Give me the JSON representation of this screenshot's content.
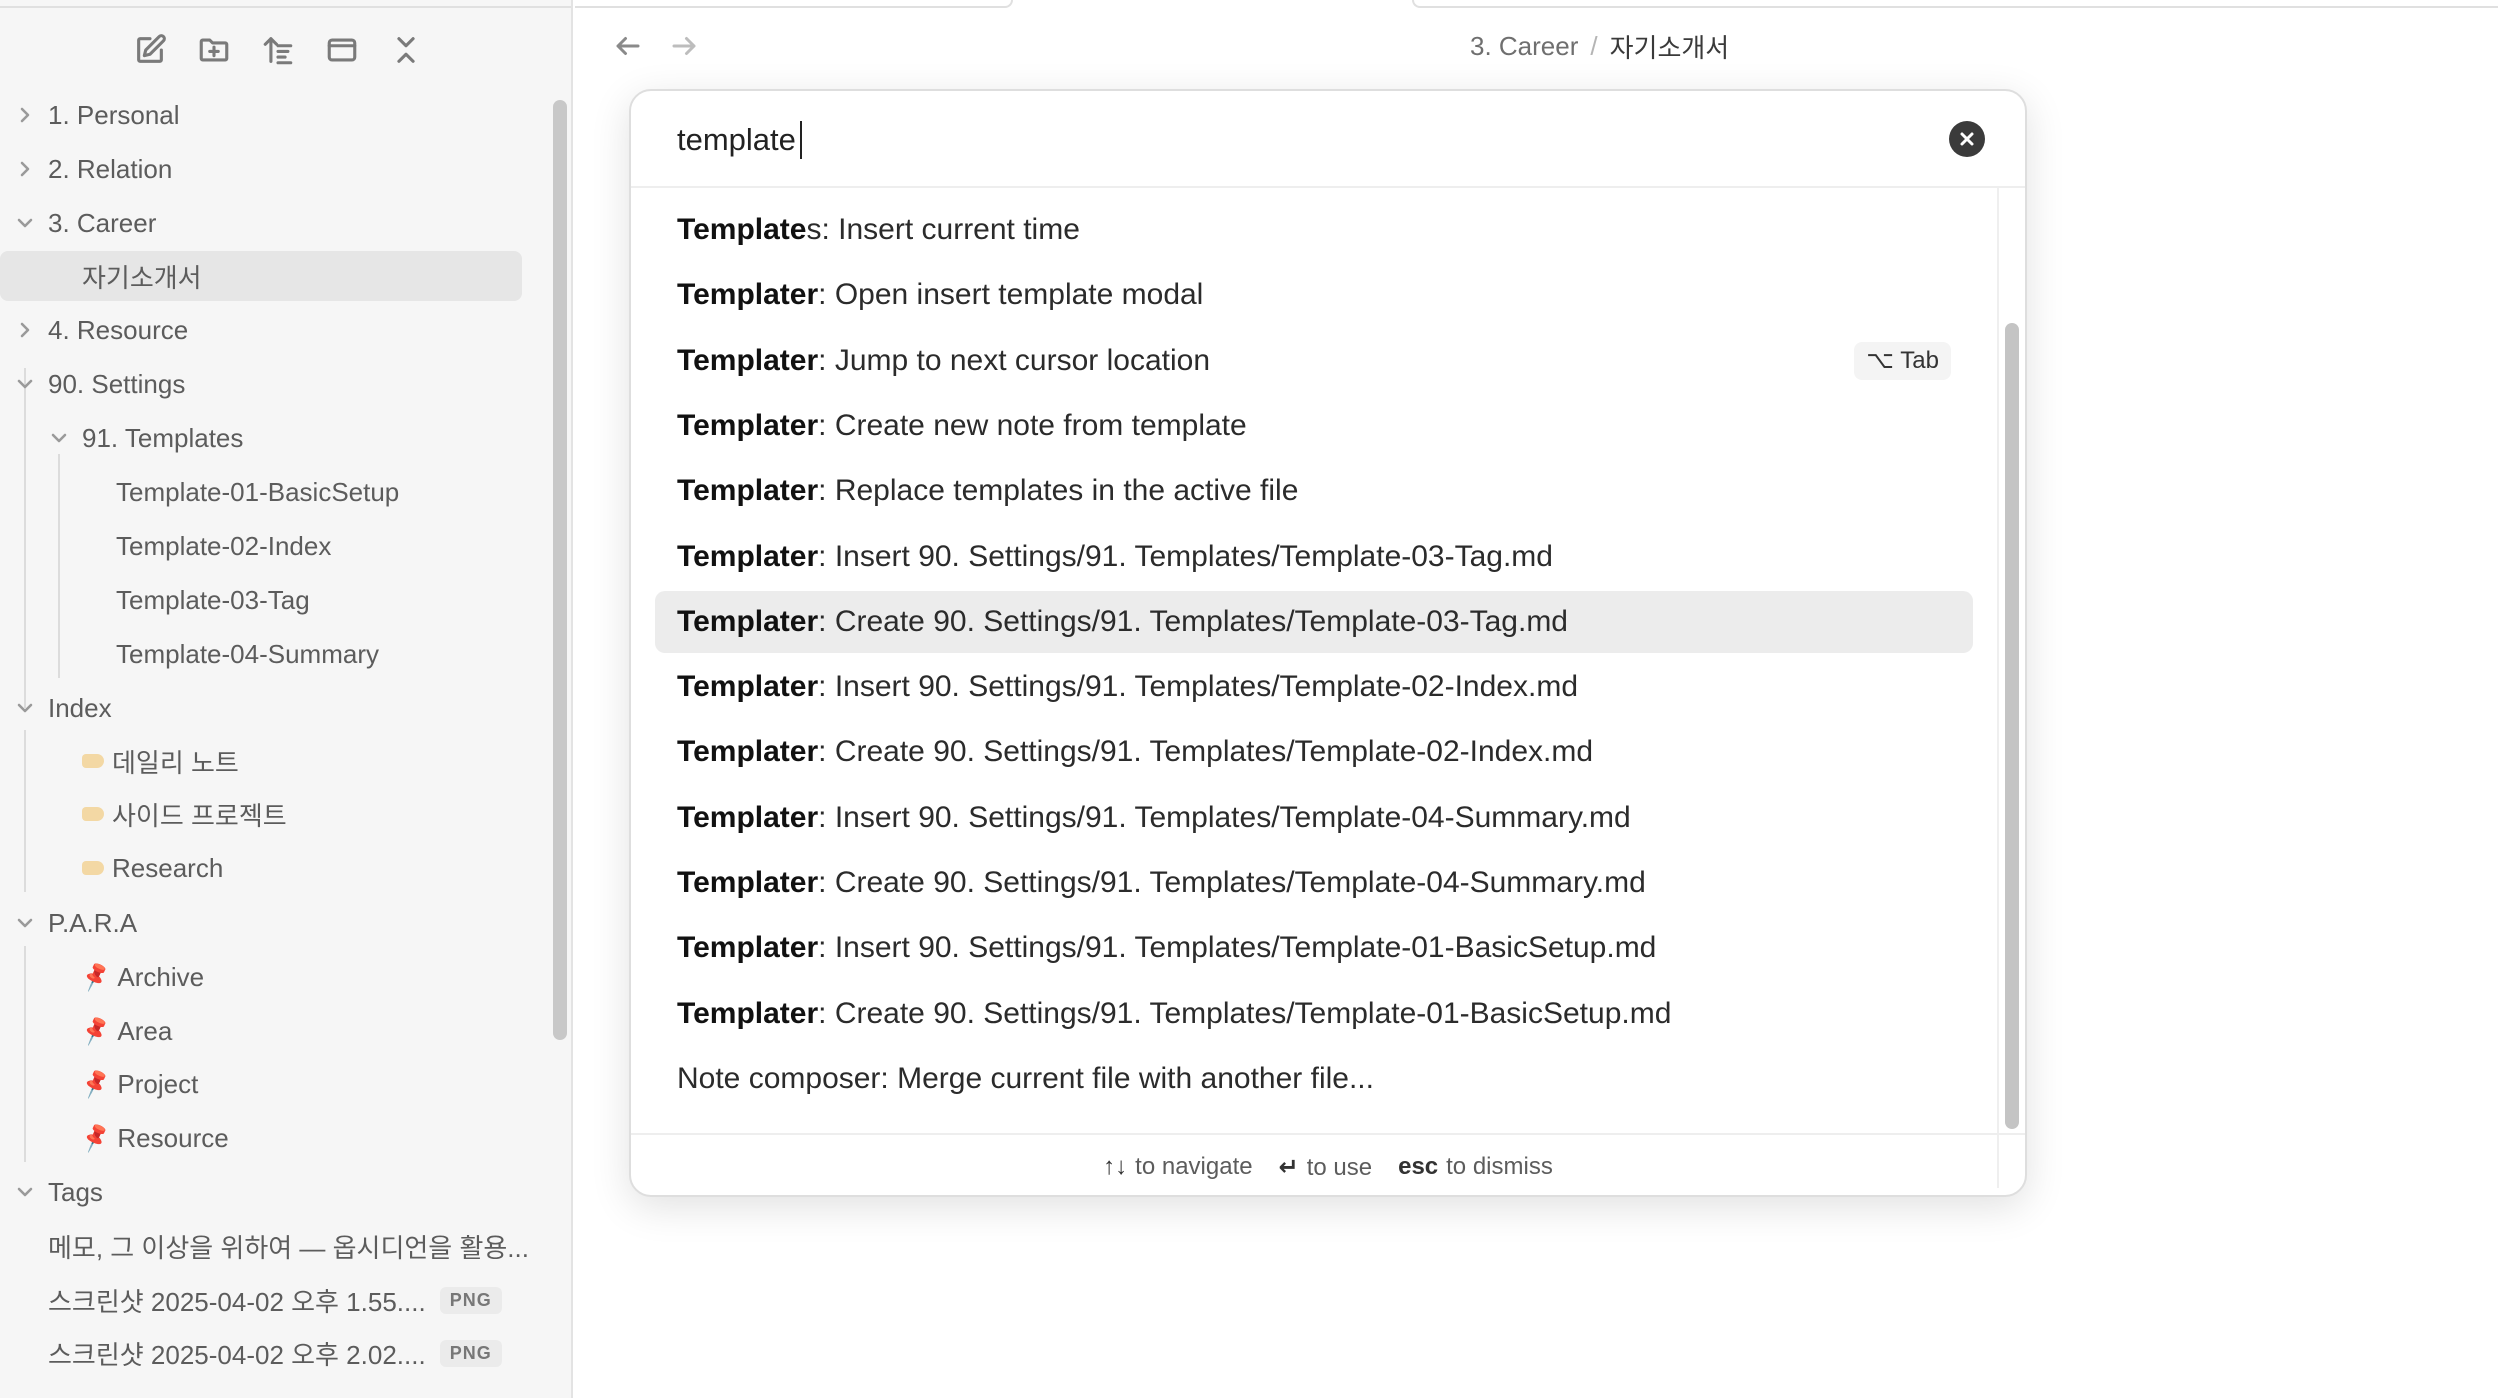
{
  "sidebar": {
    "toolbar": [
      {
        "name": "new-note-icon"
      },
      {
        "name": "new-folder-icon"
      },
      {
        "name": "sort-icon"
      },
      {
        "name": "collapse-panel-icon"
      },
      {
        "name": "collapse-all-icon"
      }
    ],
    "items": [
      {
        "label": "1. Personal",
        "chevron": "right"
      },
      {
        "label": "2. Relation",
        "chevron": "right"
      },
      {
        "label": "3. Career",
        "chevron": "down"
      },
      {
        "label": "자기소개서"
      },
      {
        "label": "4. Resource",
        "chevron": "right"
      },
      {
        "label": "90. Settings",
        "chevron": "down"
      },
      {
        "label": "91. Templates",
        "chevron": "down"
      },
      {
        "label": "Template-01-BasicSetup"
      },
      {
        "label": "Template-02-Index"
      },
      {
        "label": "Template-03-Tag"
      },
      {
        "label": "Template-04-Summary"
      },
      {
        "label": "Index",
        "chevron": "down"
      },
      {
        "label": "데일리 노트"
      },
      {
        "label": "사이드 프로젝트"
      },
      {
        "label": "Research"
      },
      {
        "label": "P.A.R.A",
        "chevron": "down"
      },
      {
        "label": "Archive"
      },
      {
        "label": "Area"
      },
      {
        "label": "Project"
      },
      {
        "label": "Resource"
      },
      {
        "label": "Tags",
        "chevron": "down"
      },
      {
        "label": "메모, 그 이상을 위하여 — 옵시디언을 활용..."
      },
      {
        "label": "스크린샷 2025-04-02 오후 1.55....",
        "badge": "PNG"
      },
      {
        "label": "스크린샷 2025-04-02 오후 2.02....",
        "badge": "PNG"
      }
    ]
  },
  "header": {
    "breadcrumb": {
      "parent": "3. Career",
      "separator": "/",
      "current": "자기소개서"
    }
  },
  "palette": {
    "query": "template",
    "results": [
      {
        "bold": "Template",
        "bold2": "s",
        "rest": ": Insert current time"
      },
      {
        "bold": "Templater",
        "rest": ": Open insert template modal"
      },
      {
        "bold": "Templater",
        "rest": ": Jump to next cursor location",
        "hotkey": "⌥ Tab"
      },
      {
        "bold": "Templater",
        "rest": ": Create new note from template"
      },
      {
        "bold": "Templater",
        "rest": ": Replace templates in the active file"
      },
      {
        "bold": "Templater",
        "rest": ": Insert 90. Settings/91. Templates/Template-03-Tag.md"
      },
      {
        "bold": "Templater",
        "rest": ": Create 90. Settings/91. Templates/Template-03-Tag.md",
        "selected": true
      },
      {
        "bold": "Templater",
        "rest": ": Insert 90. Settings/91. Templates/Template-02-Index.md"
      },
      {
        "bold": "Templater",
        "rest": ": Create 90. Settings/91. Templates/Template-02-Index.md"
      },
      {
        "bold": "Templater",
        "rest": ": Insert 90. Settings/91. Templates/Template-04-Summary.md"
      },
      {
        "bold": "Templater",
        "rest": ": Create 90. Settings/91. Templates/Template-04-Summary.md"
      },
      {
        "bold": "Templater",
        "rest": ": Insert 90. Settings/91. Templates/Template-01-BasicSetup.md"
      },
      {
        "bold": "Templater",
        "rest": ": Create 90. Settings/91. Templates/Template-01-BasicSetup.md"
      },
      {
        "text": "Note composer: Merge current file with another file..."
      }
    ],
    "footer": {
      "navigate_key": "↑↓",
      "navigate_label": "to navigate",
      "use_key": "↵",
      "use_label": "to use",
      "dismiss_key": "esc",
      "dismiss_label": "to dismiss"
    }
  }
}
